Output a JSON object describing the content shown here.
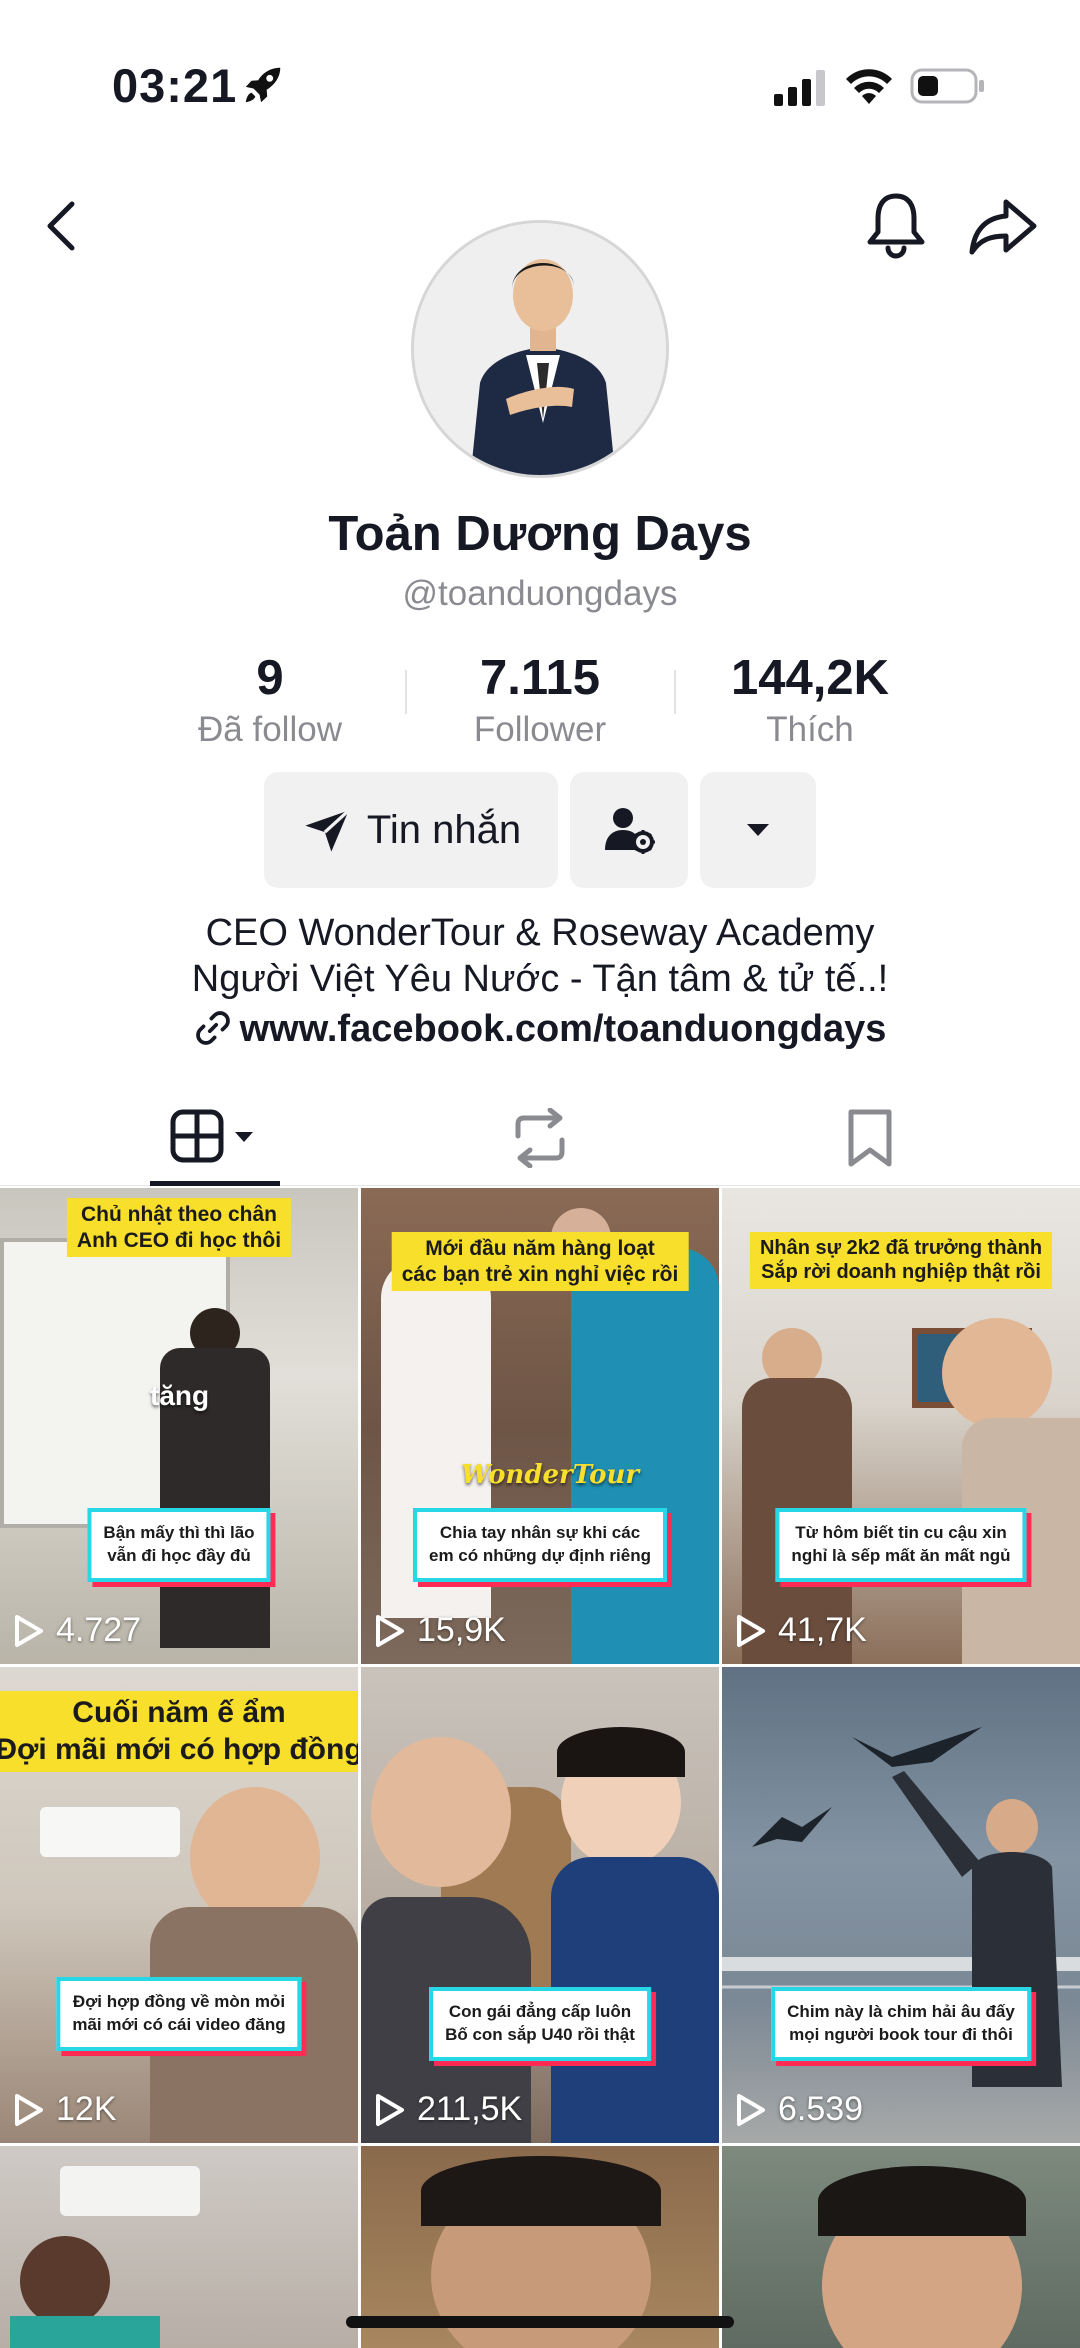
{
  "status_bar": {
    "time": "03:21"
  },
  "profile": {
    "display_name": "Toản Dương Days",
    "handle": "@toanduongdays"
  },
  "stats": [
    {
      "value": "9",
      "label": "Đã follow"
    },
    {
      "value": "7.115",
      "label": "Follower"
    },
    {
      "value": "144,2K",
      "label": "Thích"
    }
  ],
  "actions": {
    "message_label": "Tin nhắn"
  },
  "bio": {
    "line1": "CEO WonderTour & Roseway Academy",
    "line2": "Người Việt Yêu Nước - Tận tâm & tử tế..!",
    "link": "www.facebook.com/toanduongdays"
  },
  "videos": [
    {
      "title": [
        "Chủ nhật theo chân",
        "Anh CEO đi học thôi"
      ],
      "caption": [
        "Bận mấy thì thì lão",
        "vẫn đi học đầy đủ"
      ],
      "views": "4.727",
      "overlay": "tăng"
    },
    {
      "title": [
        "Mới đầu năm hàng loạt",
        "các bạn trẻ xin nghỉ việc rồi"
      ],
      "caption": [
        "Chia tay nhân sự khi các",
        "em có những dự định riêng"
      ],
      "views": "15,9K",
      "overlay": "WonderTour"
    },
    {
      "title": [
        "Nhân sự 2k2 đã trưởng thành",
        "Sắp rời doanh nghiệp thật rồi"
      ],
      "caption": [
        "Từ hôm biết tin cu cậu xin",
        "nghỉ là sếp mất ăn mất ngủ"
      ],
      "views": "41,7K"
    },
    {
      "title": [
        "Cuối năm ế ẩm",
        "Đợi mãi mới có hợp đồng"
      ],
      "caption": [
        "Đợi hợp đồng về mòn mỏi",
        "mãi mới có cái video đăng"
      ],
      "views": "12K"
    },
    {
      "caption": [
        "Con gái đẳng cấp luôn",
        "Bố con sắp U40 rồi thật"
      ],
      "views": "211,5K"
    },
    {
      "caption": [
        "Chim này là chim hải âu đấy",
        "mọi người book tour đi thôi"
      ],
      "views": "6.539"
    }
  ],
  "colors": {
    "accent_red": "#fe2c55",
    "caption_border": "#28d7e6",
    "title_yellow": "#f8df2c"
  }
}
